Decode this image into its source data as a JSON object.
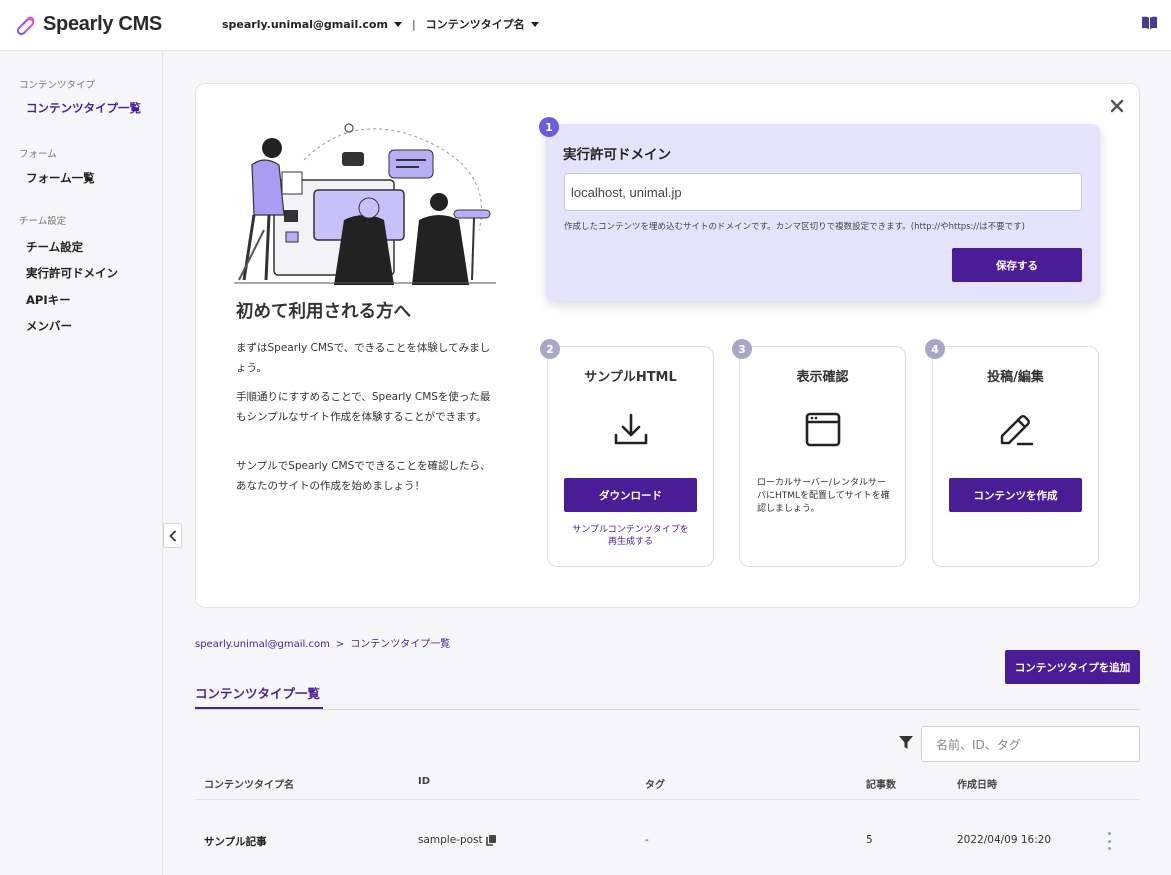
{
  "app": {
    "logo_text": "Spearly CMS"
  },
  "header": {
    "account": "spearly.unimal@gmail.com",
    "separator": "|",
    "content_type_menu": "コンテンツタイプ名"
  },
  "sidebar": {
    "sections": [
      {
        "title": "コンテンツタイプ",
        "items": [
          "コンテンツタイプ一覧"
        ]
      },
      {
        "title": "フォーム",
        "items": [
          "フォーム一覧"
        ]
      },
      {
        "title": "チーム設定",
        "items": [
          "チーム設定",
          "実行許可ドメイン",
          "APIキー",
          "メンバー"
        ]
      }
    ]
  },
  "onboarding": {
    "intro": {
      "title": "初めて利用される方へ",
      "p1": "まずはSpearly CMSで、できることを体験してみましょう。",
      "p2": "手順通りにすすめることで、Spearly CMSを使った最もシンプルなサイト作成を体験することができます。",
      "p3": "サンプルでSpearly CMSでできることを確認したら、あなたのサイトの作成を始めましょう！"
    },
    "step1": {
      "number": "1",
      "title": "実行許可ドメイン",
      "input_value": "localhost, unimal.jp",
      "help": "作成したコンテンツを埋め込むサイトのドメインです。カンマ区切りで複数設定できます。(http://やhttps://は不要です)",
      "button": "保存する"
    },
    "step2": {
      "number": "2",
      "title": "サンプルHTML",
      "icon": "download-icon",
      "button": "ダウンロード",
      "link_line1": "サンプルコンテンツタイプを",
      "link_line2": "再生成する"
    },
    "step3": {
      "number": "3",
      "title": "表示確認",
      "icon": "browser-window-icon",
      "description": "ローカルサーバー/レンタルサーバにHTMLを配置してサイトを確認しましょう。"
    },
    "step4": {
      "number": "4",
      "title": "投稿/編集",
      "icon": "pencil-icon",
      "button": "コンテンツを作成"
    }
  },
  "breadcrumb": {
    "account": "spearly.unimal@gmail.com",
    "separator": ">",
    "current": "コンテンツタイプ一覧"
  },
  "list": {
    "heading": "コンテンツタイプ一覧",
    "add_button": "コンテンツタイプを追加",
    "search_placeholder": "名前、ID、タグ",
    "columns": [
      "コンテンツタイプ名",
      "ID",
      "タグ",
      "記事数",
      "作成日時"
    ],
    "rows": [
      {
        "name": "サンプル記事",
        "id": "sample-post",
        "tag": "-",
        "count": "5",
        "created": "2022/04/09 16:20"
      }
    ]
  },
  "colors": {
    "primary": "#4a1d96",
    "badge_active": "#6a5be0",
    "badge_inactive": "#a7a7c7",
    "step1_bg": "#e5e3fb"
  }
}
